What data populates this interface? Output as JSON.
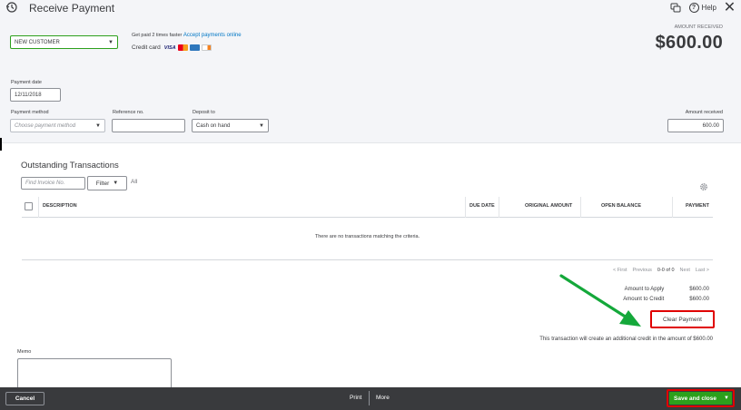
{
  "header": {
    "title": "Receive Payment",
    "help_label": "Help"
  },
  "customer": {
    "value": "NEW CUSTOMER"
  },
  "promo": {
    "text": "Get paid 2 times faster",
    "link": "Accept payments online",
    "credit_card_label": "Credit card",
    "cards": [
      "VISA",
      "mastercard",
      "amex",
      "discover"
    ]
  },
  "amount_received": {
    "label": "AMOUNT RECEIVED",
    "value": "$600.00"
  },
  "payment_date": {
    "label": "Payment date",
    "value": "12/11/2018"
  },
  "payment_method": {
    "label": "Payment method",
    "placeholder": "Choose payment method"
  },
  "reference": {
    "label": "Reference no.",
    "value": ""
  },
  "deposit_to": {
    "label": "Deposit to",
    "value": "Cash on hand"
  },
  "amount_field": {
    "label": "Amount received",
    "value": "600.00"
  },
  "outstanding": {
    "title": "Outstanding Transactions",
    "find_placeholder": "Find Invoice No.",
    "filter_label": "Filter",
    "all_label": "All",
    "columns": [
      "DESCRIPTION",
      "DUE DATE",
      "ORIGINAL AMOUNT",
      "OPEN BALANCE",
      "PAYMENT"
    ],
    "empty_message": "There are no transactions matching the criteria."
  },
  "pager": {
    "first": "< First",
    "previous": "Previous",
    "range": "0-0 of 0",
    "next": "Next",
    "last": "Last >"
  },
  "summary": {
    "apply_label": "Amount to Apply",
    "apply_value": "$600.00",
    "credit_label": "Amount to Credit",
    "credit_value": "$600.00",
    "clear_label": "Clear Payment",
    "credit_note": "This transaction will create an additional credit in the amount of $600.00"
  },
  "memo": {
    "label": "Memo"
  },
  "footer": {
    "cancel": "Cancel",
    "print": "Print",
    "more": "More",
    "save": "Save and close"
  },
  "colors": {
    "brand_green": "#2ca01c",
    "highlight_red": "#e00000",
    "annotation_arrow": "#14a83a",
    "link_blue": "#0077c5"
  }
}
